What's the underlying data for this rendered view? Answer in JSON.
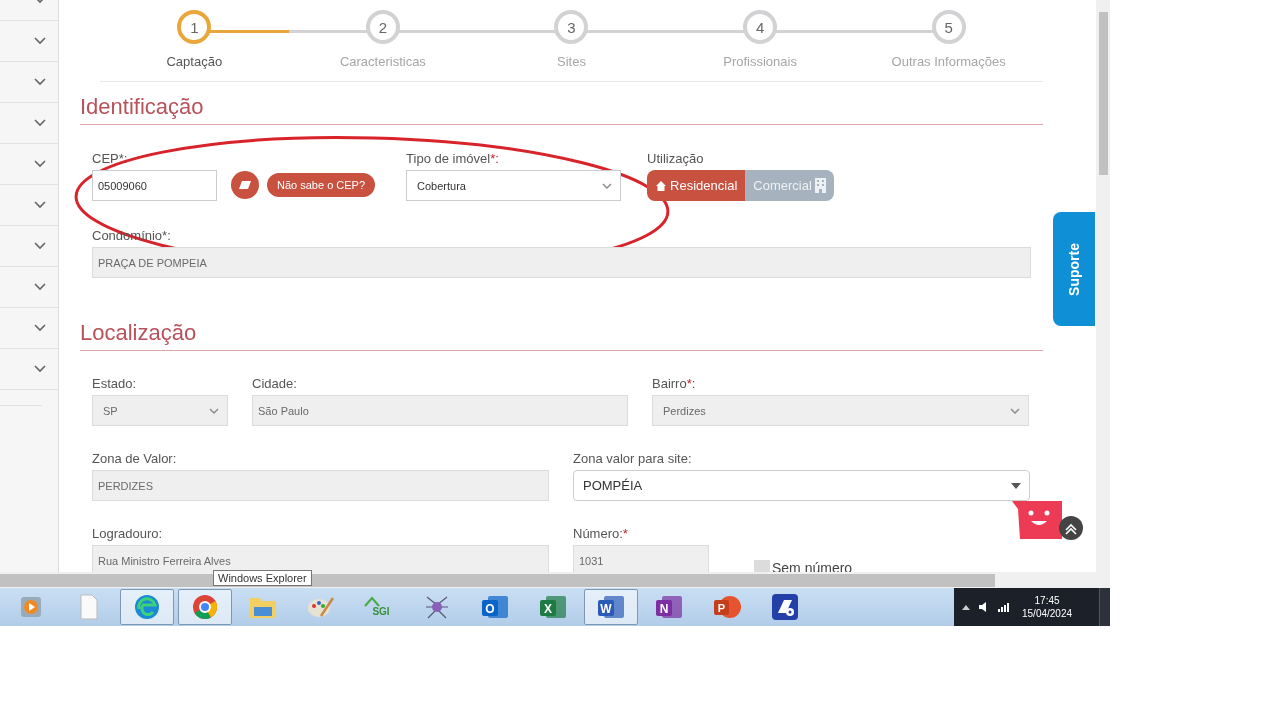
{
  "sidebar": {
    "items": [
      {
        "expanded": false
      },
      {
        "expanded": false
      },
      {
        "expanded": false
      },
      {
        "expanded": false
      },
      {
        "expanded": false
      },
      {
        "expanded": false
      },
      {
        "expanded": false
      },
      {
        "expanded": false
      },
      {
        "expanded": false
      },
      {
        "expanded": false
      }
    ]
  },
  "stepper": [
    {
      "number": "1",
      "label": "Captação",
      "selected": true
    },
    {
      "number": "2",
      "label": "Caracteristicas",
      "selected": false
    },
    {
      "number": "3",
      "label": "Sites",
      "selected": false
    },
    {
      "number": "4",
      "label": "Profissionais",
      "selected": false
    },
    {
      "number": "5",
      "label": "Outras Informações",
      "selected": false
    }
  ],
  "identificacao": {
    "title": "Identificação",
    "cep": {
      "label": "CEP*:",
      "value": "05009060"
    },
    "cep_help_button": "Não sabe o CEP?",
    "tipo": {
      "label": "Tipo de imóvel",
      "required_mark": "*:",
      "value": "Cobertura"
    },
    "utilizacao": {
      "label": "Utilização",
      "options": [
        {
          "label": "Residencial",
          "selected": true,
          "kind": "house"
        },
        {
          "label": "Comercial",
          "selected": false,
          "kind": "building"
        }
      ]
    },
    "condominio": {
      "label": "Condomínio*:",
      "value": "PRAÇA DE POMPEIA"
    }
  },
  "localizacao": {
    "title": "Localização",
    "rows": [
      [
        {
          "label": "Estado:",
          "value": "SP",
          "kind": "select",
          "disabled": true
        },
        {
          "label": "Cidade:",
          "value": "São Paulo",
          "kind": "text",
          "disabled": true
        },
        {
          "label": "Bairro",
          "required_mark": "*:",
          "value": "Perdizes",
          "kind": "select",
          "disabled": true
        }
      ],
      [
        {
          "label": "Zona de Valor:",
          "value": "PERDIZES",
          "kind": "text",
          "disabled": true
        },
        {
          "label": "Zona valor para site:",
          "value": "POMPÉIA",
          "kind": "dropdown",
          "disabled": false
        }
      ],
      [
        {
          "label": "Logradouro:",
          "value": "Rua Ministro Ferreira Alves",
          "kind": "text",
          "disabled": true
        },
        {
          "label": "Número:",
          "required_mark": "*",
          "value": "1031",
          "kind": "text",
          "disabled": true
        },
        {
          "label": "Sem número",
          "checked": false,
          "kind": "checkbox"
        }
      ]
    ]
  },
  "support_tab": "Suporte",
  "tooltip": "Windows Explorer",
  "taskbar": {
    "apps": [
      {
        "kind": "media",
        "selected": false
      },
      {
        "kind": "file",
        "selected": false
      },
      {
        "kind": "edge",
        "selected": true
      },
      {
        "kind": "chrome",
        "selected": true
      },
      {
        "kind": "explorer",
        "selected": false
      },
      {
        "kind": "paint",
        "selected": false
      },
      {
        "kind": "sgi",
        "letter": "SGI",
        "selected": false
      },
      {
        "kind": "spider",
        "selected": false
      },
      {
        "kind": "outlook",
        "letter": "O",
        "selected": false
      },
      {
        "kind": "excel",
        "letter": "X",
        "selected": false
      },
      {
        "kind": "word",
        "letter": "W",
        "selected": true
      },
      {
        "kind": "onenote",
        "letter": "N",
        "selected": false
      },
      {
        "kind": "powerpoint",
        "letter": "P",
        "selected": false
      },
      {
        "kind": "scan",
        "selected": false
      }
    ],
    "time": "17:45",
    "date": "15/04/2024"
  }
}
